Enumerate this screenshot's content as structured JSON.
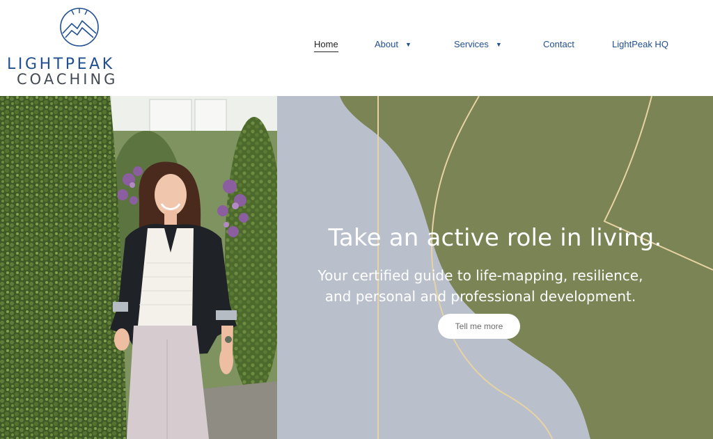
{
  "logo": {
    "line1": "LIGHTPEAK",
    "line2": "COACHING"
  },
  "nav": {
    "items": [
      {
        "label": "Home",
        "active": true,
        "has_dropdown": false
      },
      {
        "label": "About",
        "active": false,
        "has_dropdown": true
      },
      {
        "label": "Services",
        "active": false,
        "has_dropdown": true
      },
      {
        "label": "Contact",
        "active": false,
        "has_dropdown": false
      },
      {
        "label": "LightPeak HQ",
        "active": false,
        "has_dropdown": false
      }
    ],
    "dropdown_icon": "▼"
  },
  "hero": {
    "title": "Take an active role in living.",
    "subtitle_line1": "Your certified guide to life-mapping, resilience,",
    "subtitle_line2": "and personal and professional development.",
    "cta_label": "Tell me more"
  },
  "colors": {
    "brand_blue": "#1f4f8f",
    "olive": "#7b8455",
    "slate": "#b9c0cc",
    "gold_line": "#e7d2a3"
  }
}
